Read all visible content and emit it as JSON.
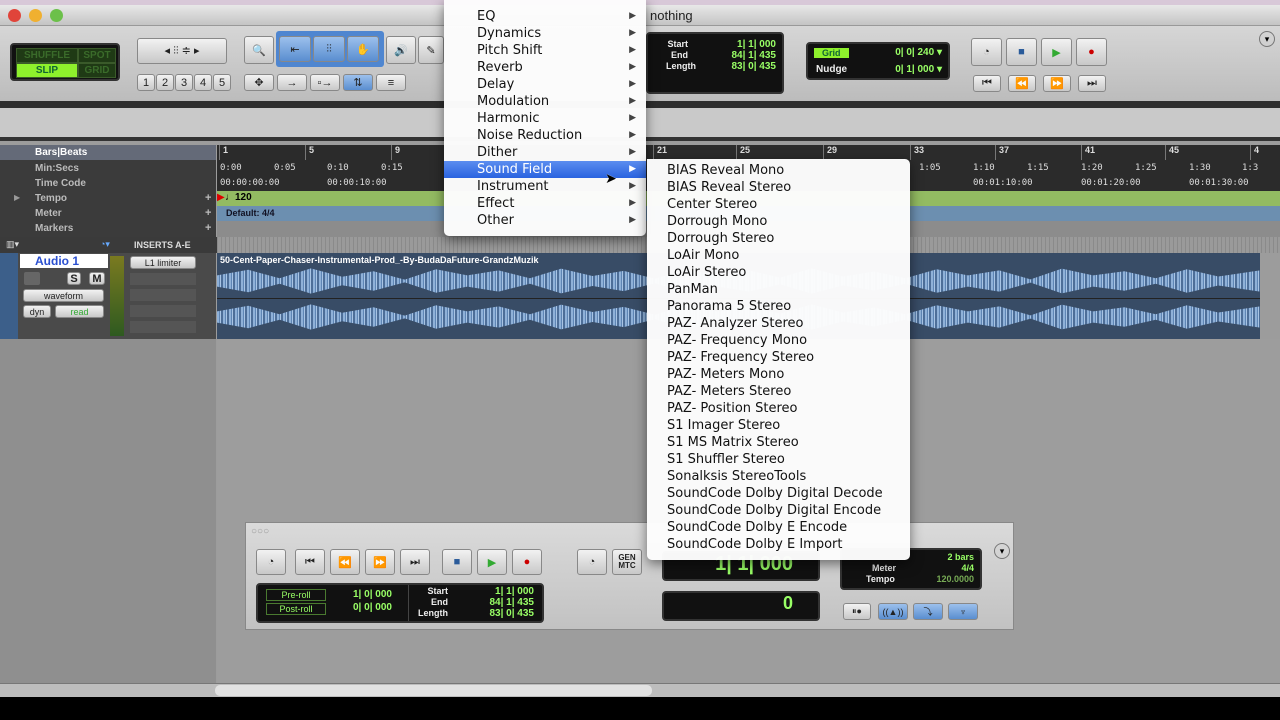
{
  "window": {
    "title": "nothing"
  },
  "toolbar": {
    "edit_modes": [
      "SHUFFLE",
      "SPOT",
      "SLIP",
      "GRID"
    ],
    "active_mode": "SLIP",
    "zoom_presets": [
      "1",
      "2",
      "3",
      "4",
      "5"
    ],
    "counter": {
      "start_label": "Start",
      "start": "1| 1| 000",
      "end_label": "End",
      "end": "84| 1| 435",
      "length_label": "Length",
      "length": "83| 0| 435",
      "main": "1| 1| 000"
    },
    "grid": {
      "label": "Grid",
      "value": "0| 0| 240"
    },
    "nudge": {
      "label": "Nudge",
      "value": "0| 1| 000"
    }
  },
  "rulers": {
    "labels": [
      "Bars|Beats",
      "Min:Secs",
      "Time Code",
      "Tempo",
      "Meter",
      "Markers"
    ],
    "bars": [
      "1",
      "5",
      "9",
      "21",
      "25",
      "29",
      "33",
      "37",
      "41",
      "45",
      "4"
    ],
    "minsecs": [
      "0:00",
      "0:05",
      "0:10",
      "0:15",
      "1:05",
      "1:10",
      "1:15",
      "1:20",
      "1:25",
      "1:30",
      "1:3"
    ],
    "timecode": [
      "00:00:00:00",
      "00:00:10:00",
      "00:01:10:00",
      "00:01:20:00",
      "00:01:30:00"
    ],
    "tempo": "120",
    "meter": "Default: 4/4"
  },
  "track": {
    "inserts_header": "INSERTS A-E",
    "name": "Audio 1",
    "solo": "S",
    "mute": "M",
    "view": "waveform",
    "dyn": "dyn",
    "automation": "read",
    "insert1": "L1 limiter",
    "clip_name": "50-Cent-Paper-Chaser-Instrumental-Prod_-By-BudaDaFuture-GrandzMuzik"
  },
  "plugin_menu": {
    "items": [
      "EQ",
      "Dynamics",
      "Pitch Shift",
      "Reverb",
      "Delay",
      "Modulation",
      "Harmonic",
      "Noise Reduction",
      "Dither",
      "Sound Field",
      "Instrument",
      "Effect",
      "Other"
    ],
    "highlighted": "Sound Field"
  },
  "sound_field_submenu": {
    "items": [
      "BIAS Reveal Mono",
      "BIAS Reveal Stereo",
      "Center Stereo",
      "Dorrough Mono",
      "Dorrough Stereo",
      "LoAir Mono",
      "LoAir Stereo",
      "PanMan",
      "Panorama 5 Stereo",
      "PAZ- Analyzer Stereo",
      "PAZ- Frequency Mono",
      "PAZ- Frequency Stereo",
      "PAZ- Meters Mono",
      "PAZ- Meters Stereo",
      "PAZ- Position Stereo",
      "S1 Imager Stereo",
      "S1 MS Matrix Stereo",
      "S1 Shuffler Stereo",
      "Sonalksis StereoTools",
      "SoundCode Dolby Digital Decode",
      "SoundCode Dolby Digital Encode",
      "SoundCode Dolby E Encode",
      "SoundCode Dolby E Import"
    ]
  },
  "transport": {
    "gen_mtc": "GEN MTC",
    "preroll_label": "Pre-roll",
    "preroll": "1| 0| 000",
    "postroll_label": "Post-roll",
    "postroll": "0| 0| 000",
    "start_label": "Start",
    "start": "1| 1| 000",
    "end_label": "End",
    "end": "84| 1| 435",
    "length_label": "Length",
    "length": "83| 0| 435",
    "main_counter": "1| 1| 000",
    "sub_counter": "0",
    "countoff": "2 bars",
    "meter_label": "Meter",
    "meter": "4/4",
    "tempo_label": "Tempo",
    "tempo": "120.0000"
  },
  "colors": {
    "lcd_green": "#99ff66",
    "menu_highlight": "#2a63e0",
    "tempo_ruler": "#93bb62",
    "meter_ruler": "#6c8fb0",
    "waveform": "#8fb1d8"
  }
}
